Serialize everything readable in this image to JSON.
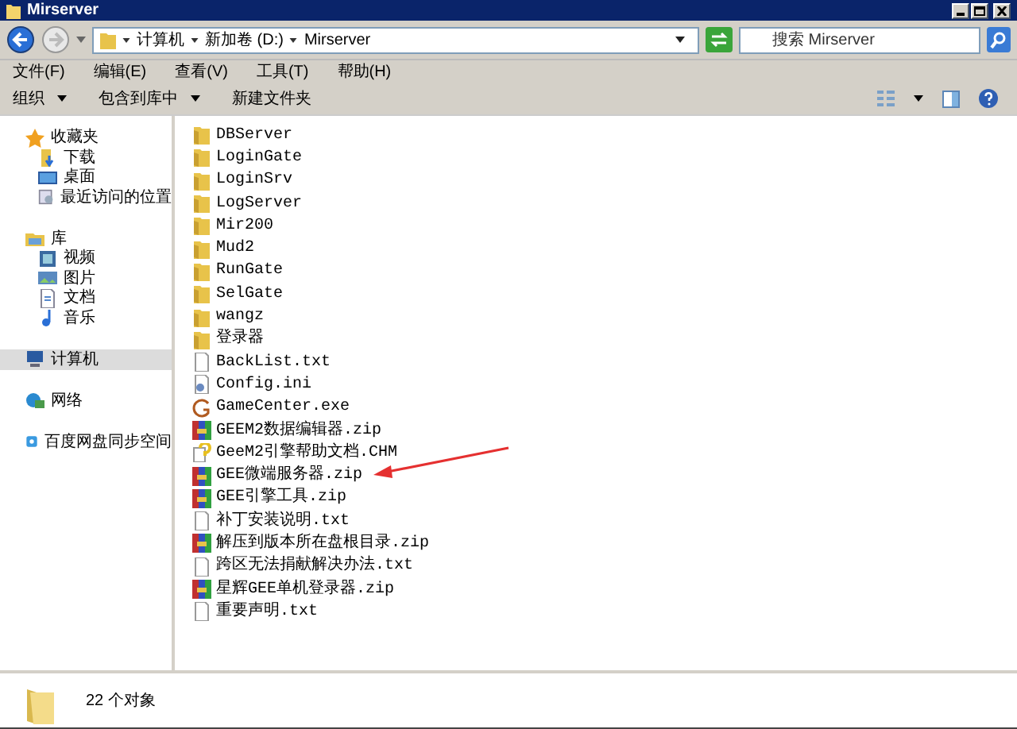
{
  "window": {
    "title": "Mirserver"
  },
  "address": {
    "crumbs": [
      "计算机",
      "新加卷 (D:)",
      "Mirserver"
    ]
  },
  "search": {
    "placeholder": "搜索 Mirserver"
  },
  "menu": [
    "文件(F)",
    "编辑(E)",
    "查看(V)",
    "工具(T)",
    "帮助(H)"
  ],
  "toolbar": [
    {
      "label": "组织",
      "dropdown": true
    },
    {
      "label": "包含到库中",
      "dropdown": true
    },
    {
      "label": "新建文件夹",
      "dropdown": false
    }
  ],
  "sidebar": {
    "groups": [
      {
        "kind": "favorites",
        "label": "收藏夹",
        "selected": false,
        "children": [
          {
            "kind": "download",
            "label": "下载"
          },
          {
            "kind": "desktop",
            "label": "桌面"
          },
          {
            "kind": "recent",
            "label": "最近访问的位置"
          }
        ]
      },
      {
        "kind": "library",
        "label": "库",
        "selected": false,
        "children": [
          {
            "kind": "video",
            "label": "视频"
          },
          {
            "kind": "picture",
            "label": "图片"
          },
          {
            "kind": "doc",
            "label": "文档"
          },
          {
            "kind": "music",
            "label": "音乐"
          }
        ]
      },
      {
        "kind": "computer",
        "label": "计算机",
        "selected": true
      },
      {
        "kind": "network",
        "label": "网络",
        "selected": false
      },
      {
        "kind": "cloud",
        "label": "百度网盘同步空间",
        "selected": false
      }
    ]
  },
  "files": [
    {
      "kind": "folder",
      "name": "DBServer"
    },
    {
      "kind": "folder",
      "name": "LoginGate"
    },
    {
      "kind": "folder",
      "name": "LoginSrv"
    },
    {
      "kind": "folder",
      "name": "LogServer"
    },
    {
      "kind": "folder",
      "name": "Mir200"
    },
    {
      "kind": "folder",
      "name": "Mud2"
    },
    {
      "kind": "folder",
      "name": "RunGate"
    },
    {
      "kind": "folder",
      "name": "SelGate"
    },
    {
      "kind": "folder",
      "name": "wangz"
    },
    {
      "kind": "folder",
      "name": "登录器"
    },
    {
      "kind": "txt",
      "name": "BackList.txt"
    },
    {
      "kind": "ini",
      "name": "Config.ini"
    },
    {
      "kind": "exe",
      "name": "GameCenter.exe"
    },
    {
      "kind": "zip",
      "name": "GEEM2数据编辑器.zip"
    },
    {
      "kind": "chm",
      "name": "GeeM2引擎帮助文档.CHM"
    },
    {
      "kind": "zip",
      "name": "GEE微端服务器.zip"
    },
    {
      "kind": "zip",
      "name": "GEE引擎工具.zip"
    },
    {
      "kind": "txt",
      "name": "补丁安装说明.txt"
    },
    {
      "kind": "zip",
      "name": "解压到版本所在盘根目录.zip"
    },
    {
      "kind": "txt",
      "name": "跨区无法捐献解决办法.txt"
    },
    {
      "kind": "zip",
      "name": "星辉GEE单机登录器.zip"
    },
    {
      "kind": "txt",
      "name": "重要声明.txt"
    }
  ],
  "status_bar": {
    "count": "22 个对象"
  }
}
